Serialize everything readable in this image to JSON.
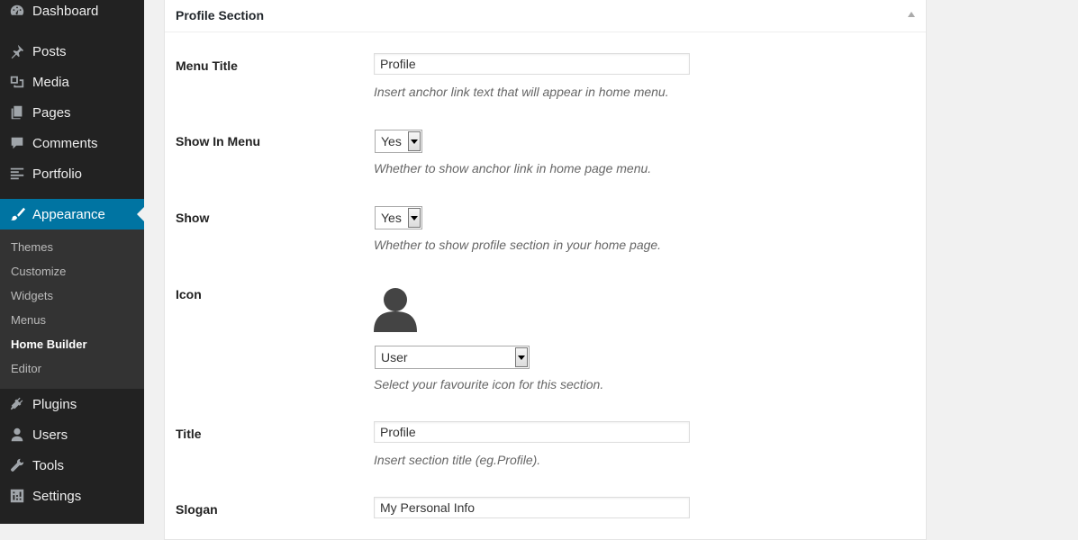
{
  "sidebar": {
    "menu": [
      {
        "label": "Dashboard",
        "icon": "dashboard-icon"
      },
      {
        "label": "Posts",
        "icon": "pin-icon"
      },
      {
        "label": "Media",
        "icon": "media-icon"
      },
      {
        "label": "Pages",
        "icon": "pages-icon"
      },
      {
        "label": "Comments",
        "icon": "comments-icon"
      },
      {
        "label": "Portfolio",
        "icon": "portfolio-icon"
      },
      {
        "label": "Appearance",
        "icon": "paintbrush-icon"
      },
      {
        "label": "Plugins",
        "icon": "plugins-icon"
      },
      {
        "label": "Users",
        "icon": "users-icon"
      },
      {
        "label": "Tools",
        "icon": "tools-icon"
      },
      {
        "label": "Settings",
        "icon": "settings-icon"
      }
    ],
    "submenu": [
      "Themes",
      "Customize",
      "Widgets",
      "Menus",
      "Home Builder",
      "Editor"
    ],
    "active": "Appearance",
    "current_sub": "Home Builder"
  },
  "panel": {
    "title": "Profile Section",
    "fields": {
      "menu_title": {
        "label": "Menu Title",
        "value": "Profile",
        "desc": "Insert anchor link text that will appear in home menu."
      },
      "show_in_menu": {
        "label": "Show In Menu",
        "value": "Yes",
        "desc": "Whether to show anchor link in home page menu."
      },
      "show": {
        "label": "Show",
        "value": "Yes",
        "desc": "Whether to show profile section in your home page."
      },
      "icon": {
        "label": "Icon",
        "value": "User",
        "preview_icon": "user-icon",
        "desc": "Select your favourite icon for this section."
      },
      "title": {
        "label": "Title",
        "value": "Profile",
        "desc": "Insert section title (eg.Profile)."
      },
      "slogan": {
        "label": "Slogan",
        "value": "My Personal Info"
      }
    }
  },
  "colors": {
    "sidebar_bg": "#222222",
    "submenu_bg": "#333333",
    "active_bg": "#0074a2",
    "page_bg": "#f1f1f1"
  }
}
